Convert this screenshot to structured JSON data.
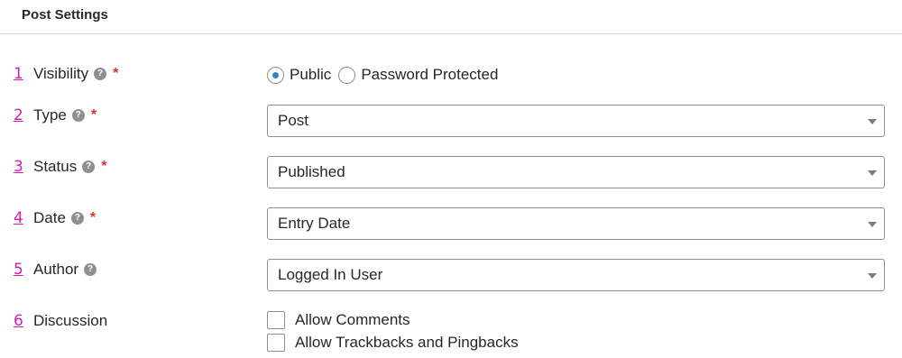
{
  "section": {
    "title": "Post Settings"
  },
  "fields": {
    "visibility": {
      "number": "1",
      "label": "Visibility",
      "required_mark": "*",
      "help_glyph": "?",
      "options": [
        {
          "label": "Public",
          "checked": true
        },
        {
          "label": "Password Protected",
          "checked": false
        }
      ]
    },
    "type": {
      "number": "2",
      "label": "Type",
      "required_mark": "*",
      "help_glyph": "?",
      "value": "Post"
    },
    "status": {
      "number": "3",
      "label": "Status",
      "required_mark": "*",
      "help_glyph": "?",
      "value": "Published"
    },
    "date": {
      "number": "4",
      "label": "Date",
      "required_mark": "*",
      "help_glyph": "?",
      "value": "Entry Date"
    },
    "author": {
      "number": "5",
      "label": "Author",
      "help_glyph": "?",
      "value": "Logged In User"
    },
    "discussion": {
      "number": "6",
      "label": "Discussion",
      "options": [
        {
          "label": "Allow Comments",
          "checked": false
        },
        {
          "label": "Allow Trackbacks and Pingbacks",
          "checked": false
        }
      ]
    }
  },
  "colors": {
    "number_marker": "#d41bb6",
    "required": "#d63638",
    "radio_accent": "#3582c4",
    "border": "#8c8f94"
  }
}
